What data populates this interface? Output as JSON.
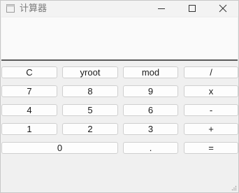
{
  "window": {
    "title": "计算器"
  },
  "display": {
    "value": ""
  },
  "keys": {
    "row1": [
      "C",
      "yroot",
      "mod",
      "/"
    ],
    "row2": [
      "7",
      "8",
      "9",
      "x"
    ],
    "row3": [
      "4",
      "5",
      "6",
      "-"
    ],
    "row4": [
      "1",
      "2",
      "3",
      "+"
    ],
    "row5": [
      "0",
      ".",
      "="
    ]
  }
}
